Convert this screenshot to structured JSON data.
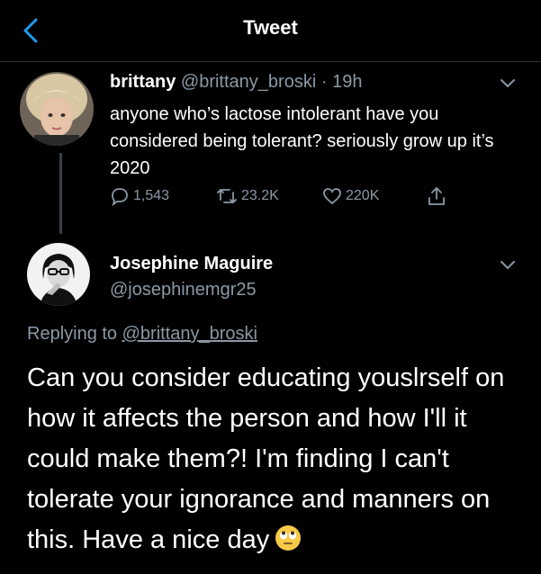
{
  "header": {
    "title": "Tweet"
  },
  "original_tweet": {
    "display_name": "brittany",
    "handle": "@brittany_broski",
    "separator": "·",
    "time": "19h",
    "text": "anyone who’s lactose intolerant have you considered being tolerant? seriously grow up it’s 2020",
    "replies": "1,543",
    "retweets": "23.2K",
    "likes": "220K"
  },
  "reply_tweet": {
    "display_name": "Josephine Maguire",
    "handle": "@josephinemgr25",
    "replying_prefix": "Replying to",
    "replying_to": "@brittany_broski",
    "text": "Can you consider educating youslrself on how it affects the person and how I'll it could make them?! I'm finding I can't tolerate your ignorance and manners on this. Have a nice day",
    "emoji": "face-with-rolling-eyes"
  },
  "colors": {
    "background": "#000000",
    "text": "#ffffff",
    "muted": "#8b98a5",
    "divider": "#2f3336"
  }
}
